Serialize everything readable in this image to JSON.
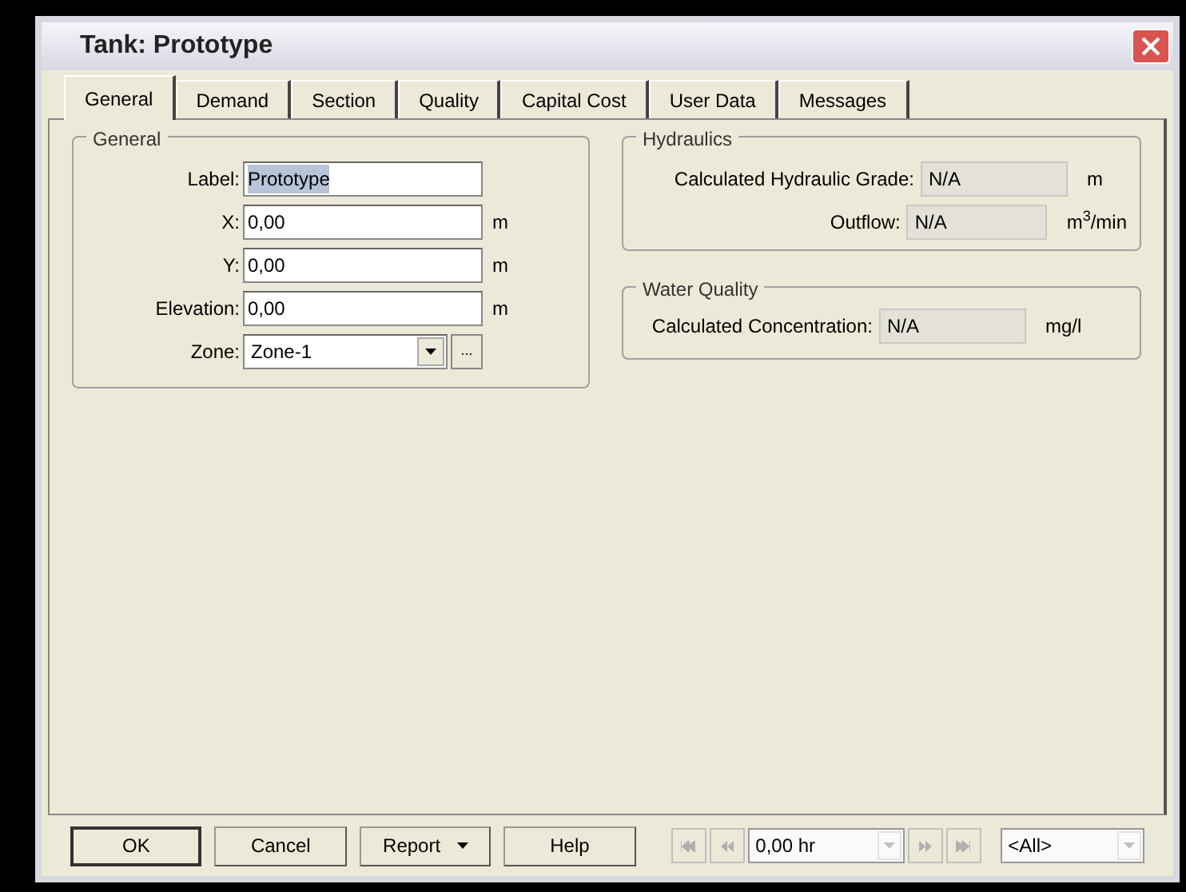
{
  "window": {
    "title": "Tank: Prototype"
  },
  "tabs": [
    {
      "label": "General",
      "selected": true
    },
    {
      "label": "Demand",
      "selected": false
    },
    {
      "label": "Section",
      "selected": false
    },
    {
      "label": "Quality",
      "selected": false
    },
    {
      "label": "Capital Cost",
      "selected": false
    },
    {
      "label": "User Data",
      "selected": false
    },
    {
      "label": "Messages",
      "selected": false
    }
  ],
  "general": {
    "title": "General",
    "fields": [
      {
        "label": "Label:",
        "value": "Prototype",
        "kind": "text",
        "selected": true
      },
      {
        "label": "X:",
        "value": "0,00",
        "unit": "m",
        "kind": "text",
        "selected": false
      },
      {
        "label": "Y:",
        "value": "0,00",
        "unit": "m",
        "kind": "text",
        "selected": false
      },
      {
        "label": "Elevation:",
        "value": "0,00",
        "unit": "m",
        "kind": "text",
        "selected": false
      },
      {
        "label": "Zone:",
        "value": "Zone-1",
        "kind": "combo",
        "selected": false,
        "button": "..."
      }
    ]
  },
  "hydraulics": {
    "title": "Hydraulics",
    "fields": [
      {
        "label": "Calculated Hydraulic Grade:",
        "value": "N/A",
        "unit": "m"
      },
      {
        "label": "Outflow:",
        "value": "N/A",
        "unit": "m$^{3}$/min"
      }
    ]
  },
  "water_quality": {
    "title": "Water Quality",
    "fields": [
      {
        "label": "Calculated Concentration:",
        "value": "N/A",
        "unit": "mg/l"
      }
    ]
  },
  "buttons": [
    {
      "label": "OK",
      "kind": "default"
    },
    {
      "label": "Cancel",
      "kind": "plain"
    },
    {
      "label": "Report",
      "kind": "menu"
    },
    {
      "label": "Help",
      "kind": "mnemonic"
    }
  ],
  "time": {
    "value": "0,00 hr",
    "disabled": true
  },
  "filter": {
    "value": "<All>",
    "disabled": true
  }
}
